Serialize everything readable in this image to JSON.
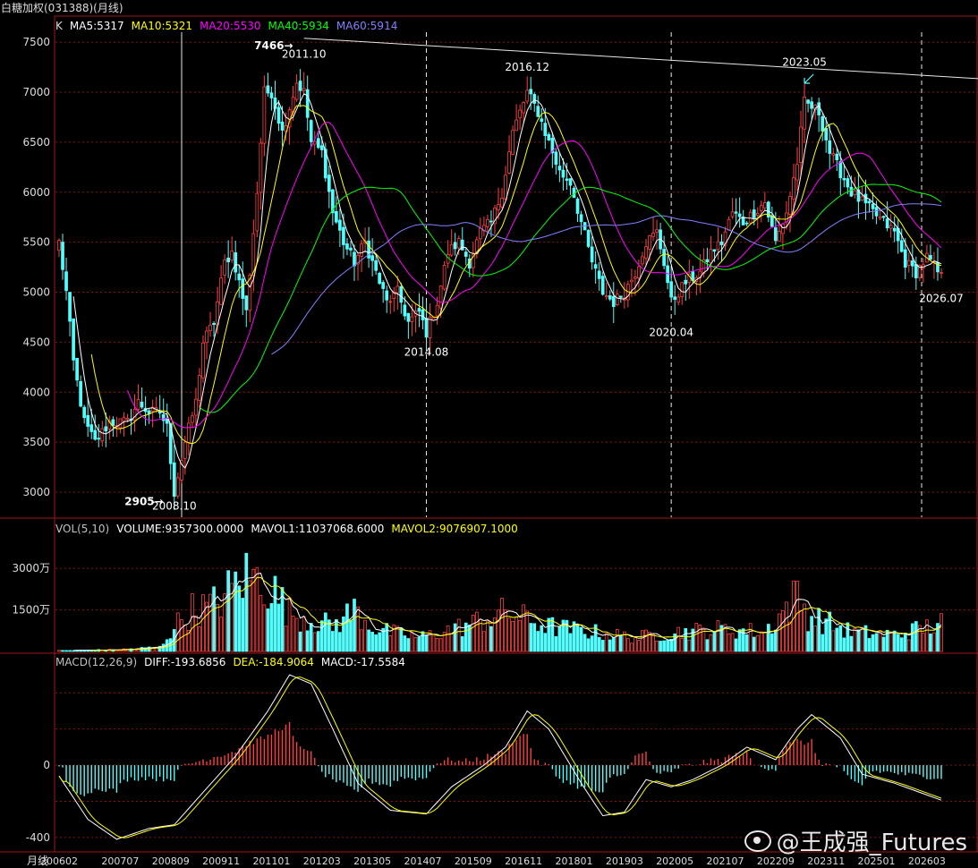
{
  "window_title": "白糖加权(031388)(月线)",
  "price_legend": {
    "k_label": "K",
    "items": [
      {
        "text": "MA5:5317",
        "color": "#ffffff"
      },
      {
        "text": "MA10:5321",
        "color": "#ffff00"
      },
      {
        "text": "MA20:5530",
        "color": "#ff00ff"
      },
      {
        "text": "MA40:5934",
        "color": "#00ff00"
      },
      {
        "text": "MA60:5914",
        "color": "#8080ff"
      }
    ]
  },
  "volume_legend": {
    "items": [
      {
        "text": "VOL(5,10)",
        "color": "#c0c0c0"
      },
      {
        "text": "VOLUME:9357300.0000",
        "color": "#ffffff"
      },
      {
        "text": "MAVOL1:11037068.6000",
        "color": "#ffffff"
      },
      {
        "text": "MAVOL2:9076907.1000",
        "color": "#ffff00"
      }
    ]
  },
  "macd_legend": {
    "items": [
      {
        "text": "MACD(12,26,9)",
        "color": "#c0c0c0"
      },
      {
        "text": "DIFF:-193.6856",
        "color": "#ffffff"
      },
      {
        "text": "DEA:-184.9064",
        "color": "#ffff00"
      },
      {
        "text": "MACD:-17.5584",
        "color": "#ffffff"
      }
    ]
  },
  "period_label": "月线",
  "watermark": "@王成强_Futures",
  "chart_data": [
    {
      "type": "candlestick",
      "panel": "price",
      "ylim": [
        2750,
        7600
      ],
      "y_ticks": [
        3000,
        3500,
        4000,
        4500,
        5000,
        5500,
        6000,
        6500,
        7000,
        7500
      ],
      "x_ticks": [
        "200602",
        "200707",
        "200809",
        "200911",
        "201101",
        "201203",
        "201305",
        "201407",
        "201509",
        "201611",
        "201801",
        "201903",
        "202005",
        "202107",
        "202209",
        "202311",
        "202501",
        "202603"
      ],
      "anchors": [
        {
          "date": "2006-02",
          "close": 5500
        },
        {
          "date": "2006-04",
          "close": 5000
        },
        {
          "date": "2006-06",
          "close": 4300
        },
        {
          "date": "2006-09",
          "close": 3700
        },
        {
          "date": "2006-12",
          "close": 3500
        },
        {
          "date": "2007-04",
          "close": 3700
        },
        {
          "date": "2007-09",
          "close": 3700
        },
        {
          "date": "2007-12",
          "close": 3900
        },
        {
          "date": "2008-03",
          "close": 3800
        },
        {
          "date": "2008-06",
          "close": 3800
        },
        {
          "date": "2008-08",
          "close": 3650
        },
        {
          "date": "2008-10",
          "close": 3000
        },
        {
          "date": "2009-01",
          "close": 3500
        },
        {
          "date": "2009-04",
          "close": 3900
        },
        {
          "date": "2009-06",
          "close": 4500
        },
        {
          "date": "2009-09",
          "close": 4700
        },
        {
          "date": "2009-12",
          "close": 5300
        },
        {
          "date": "2010-02",
          "close": 5400
        },
        {
          "date": "2010-06",
          "close": 4800
        },
        {
          "date": "2010-09",
          "close": 6000
        },
        {
          "date": "2010-11",
          "close": 7000
        },
        {
          "date": "2011-01",
          "close": 7000
        },
        {
          "date": "2011-04",
          "close": 6600
        },
        {
          "date": "2011-08",
          "close": 7100
        },
        {
          "date": "2011-10",
          "close": 7000
        },
        {
          "date": "2011-12",
          "close": 6500
        },
        {
          "date": "2012-03",
          "close": 6400
        },
        {
          "date": "2012-06",
          "close": 5800
        },
        {
          "date": "2012-09",
          "close": 5500
        },
        {
          "date": "2012-12",
          "close": 5300
        },
        {
          "date": "2013-03",
          "close": 5500
        },
        {
          "date": "2013-06",
          "close": 5200
        },
        {
          "date": "2013-09",
          "close": 4900
        },
        {
          "date": "2013-12",
          "close": 5000
        },
        {
          "date": "2014-03",
          "close": 4700
        },
        {
          "date": "2014-06",
          "close": 4800
        },
        {
          "date": "2014-08",
          "close": 4600
        },
        {
          "date": "2014-11",
          "close": 4900
        },
        {
          "date": "2015-02",
          "close": 5400
        },
        {
          "date": "2015-05",
          "close": 5500
        },
        {
          "date": "2015-08",
          "close": 5300
        },
        {
          "date": "2015-11",
          "close": 5600
        },
        {
          "date": "2016-02",
          "close": 5700
        },
        {
          "date": "2016-05",
          "close": 6000
        },
        {
          "date": "2016-08",
          "close": 6600
        },
        {
          "date": "2016-12",
          "close": 7000
        },
        {
          "date": "2017-03",
          "close": 6800
        },
        {
          "date": "2017-06",
          "close": 6500
        },
        {
          "date": "2017-09",
          "close": 6200
        },
        {
          "date": "2017-12",
          "close": 6100
        },
        {
          "date": "2018-03",
          "close": 5700
        },
        {
          "date": "2018-06",
          "close": 5300
        },
        {
          "date": "2018-09",
          "close": 5000
        },
        {
          "date": "2018-12",
          "close": 4900
        },
        {
          "date": "2019-03",
          "close": 5000
        },
        {
          "date": "2019-06",
          "close": 5200
        },
        {
          "date": "2019-09",
          "close": 5500
        },
        {
          "date": "2019-12",
          "close": 5600
        },
        {
          "date": "2020-02",
          "close": 5300
        },
        {
          "date": "2020-04",
          "close": 4900
        },
        {
          "date": "2020-08",
          "close": 5100
        },
        {
          "date": "2020-12",
          "close": 5200
        },
        {
          "date": "2021-03",
          "close": 5400
        },
        {
          "date": "2021-06",
          "close": 5500
        },
        {
          "date": "2021-09",
          "close": 5800
        },
        {
          "date": "2021-12",
          "close": 5700
        },
        {
          "date": "2022-03",
          "close": 5800
        },
        {
          "date": "2022-06",
          "close": 5900
        },
        {
          "date": "2022-09",
          "close": 5500
        },
        {
          "date": "2022-12",
          "close": 5800
        },
        {
          "date": "2023-03",
          "close": 6300
        },
        {
          "date": "2023-05",
          "close": 6900
        },
        {
          "date": "2023-09",
          "close": 6800
        },
        {
          "date": "2023-12",
          "close": 6400
        },
        {
          "date": "2024-03",
          "close": 6200
        },
        {
          "date": "2024-06",
          "close": 6000
        },
        {
          "date": "2024-09",
          "close": 5900
        },
        {
          "date": "2024-12",
          "close": 5800
        },
        {
          "date": "2025-03",
          "close": 5700
        },
        {
          "date": "2025-06",
          "close": 5600
        },
        {
          "date": "2025-09",
          "close": 5300
        },
        {
          "date": "2025-12",
          "close": 5200
        },
        {
          "date": "2026-03",
          "close": 5350
        },
        {
          "date": "2026-07",
          "close": 5150
        }
      ],
      "annotations": [
        {
          "text": "2905→",
          "date": "2008-07",
          "value": 2905
        },
        {
          "text": "2008.10",
          "date": "2008-10",
          "value": 2860
        },
        {
          "text": "7466→",
          "date": "2011-07",
          "value": 7466
        },
        {
          "text": "2011.10",
          "date": "2011-10",
          "value": 7380
        },
        {
          "text": "2014.08",
          "date": "2014-08",
          "value": 4400
        },
        {
          "text": "2016.12",
          "date": "2016-12",
          "value": 7250
        },
        {
          "text": "2020.04",
          "date": "2020-04",
          "value": 4600
        },
        {
          "text": "2023.05",
          "date": "2023-05",
          "value": 7300
        },
        {
          "text": "2026.07",
          "date": "2026-07",
          "value": 4940
        }
      ],
      "vertical_markers": [
        "2008-10",
        "2014-08",
        "2020-04",
        "2026-07"
      ],
      "trendline": [
        {
          "date": "2011-10",
          "value": 7540
        },
        {
          "date": "2026-10",
          "value": 7130
        }
      ]
    },
    {
      "type": "bar",
      "panel": "volume",
      "ylim": [
        0,
        4200
      ],
      "y_ticks": [
        1500,
        3000
      ],
      "y_tick_labels": [
        "1500万",
        "3000万"
      ],
      "unit": "万",
      "anchors": [
        {
          "date": "2006-02",
          "value": 30
        },
        {
          "date": "2007-06",
          "value": 60
        },
        {
          "date": "2008-06",
          "value": 150
        },
        {
          "date": "2008-10",
          "value": 900
        },
        {
          "date": "2009-03",
          "value": 1500
        },
        {
          "date": "2009-08",
          "value": 1600
        },
        {
          "date": "2009-12",
          "value": 2000
        },
        {
          "date": "2010-05",
          "value": 2700
        },
        {
          "date": "2010-11",
          "value": 2600
        },
        {
          "date": "2011-06",
          "value": 1400
        },
        {
          "date": "2012-06",
          "value": 900
        },
        {
          "date": "2012-12",
          "value": 1500
        },
        {
          "date": "2013-06",
          "value": 800
        },
        {
          "date": "2014-06",
          "value": 500
        },
        {
          "date": "2015-06",
          "value": 900
        },
        {
          "date": "2016-06",
          "value": 1400
        },
        {
          "date": "2017-06",
          "value": 900
        },
        {
          "date": "2018-06",
          "value": 700
        },
        {
          "date": "2019-06",
          "value": 500
        },
        {
          "date": "2020-06",
          "value": 700
        },
        {
          "date": "2021-06",
          "value": 800
        },
        {
          "date": "2022-06",
          "value": 700
        },
        {
          "date": "2023-03",
          "value": 2000
        },
        {
          "date": "2023-06",
          "value": 1300
        },
        {
          "date": "2024-06",
          "value": 700
        },
        {
          "date": "2025-06",
          "value": 600
        },
        {
          "date": "2026-07",
          "value": 1000
        }
      ]
    },
    {
      "type": "bar",
      "panel": "macd",
      "ylim": [
        -480,
        530
      ],
      "y_ticks": [
        -400,
        0
      ],
      "series_lines": [
        "DIFF",
        "DEA"
      ],
      "anchors": [
        {
          "date": "2006-02",
          "value": -60
        },
        {
          "date": "2006-10",
          "value": -300
        },
        {
          "date": "2007-06",
          "value": -410
        },
        {
          "date": "2008-03",
          "value": -350
        },
        {
          "date": "2008-10",
          "value": -330
        },
        {
          "date": "2009-06",
          "value": -150
        },
        {
          "date": "2010-03",
          "value": 50
        },
        {
          "date": "2010-12",
          "value": 300
        },
        {
          "date": "2011-06",
          "value": 500
        },
        {
          "date": "2011-12",
          "value": 450
        },
        {
          "date": "2012-06",
          "value": 200
        },
        {
          "date": "2013-01",
          "value": -100
        },
        {
          "date": "2013-10",
          "value": -250
        },
        {
          "date": "2014-08",
          "value": -270
        },
        {
          "date": "2015-03",
          "value": -120
        },
        {
          "date": "2015-12",
          "value": 0
        },
        {
          "date": "2016-06",
          "value": 100
        },
        {
          "date": "2016-12",
          "value": 300
        },
        {
          "date": "2017-06",
          "value": 200
        },
        {
          "date": "2018-03",
          "value": -100
        },
        {
          "date": "2018-09",
          "value": -280
        },
        {
          "date": "2019-03",
          "value": -260
        },
        {
          "date": "2019-09",
          "value": -80
        },
        {
          "date": "2020-04",
          "value": -120
        },
        {
          "date": "2020-10",
          "value": -80
        },
        {
          "date": "2021-06",
          "value": 0
        },
        {
          "date": "2022-01",
          "value": 100
        },
        {
          "date": "2022-09",
          "value": 30
        },
        {
          "date": "2023-03",
          "value": 200
        },
        {
          "date": "2023-07",
          "value": 280
        },
        {
          "date": "2024-03",
          "value": 150
        },
        {
          "date": "2024-09",
          "value": -50
        },
        {
          "date": "2025-06",
          "value": -100
        },
        {
          "date": "2026-07",
          "value": -194
        }
      ]
    }
  ]
}
